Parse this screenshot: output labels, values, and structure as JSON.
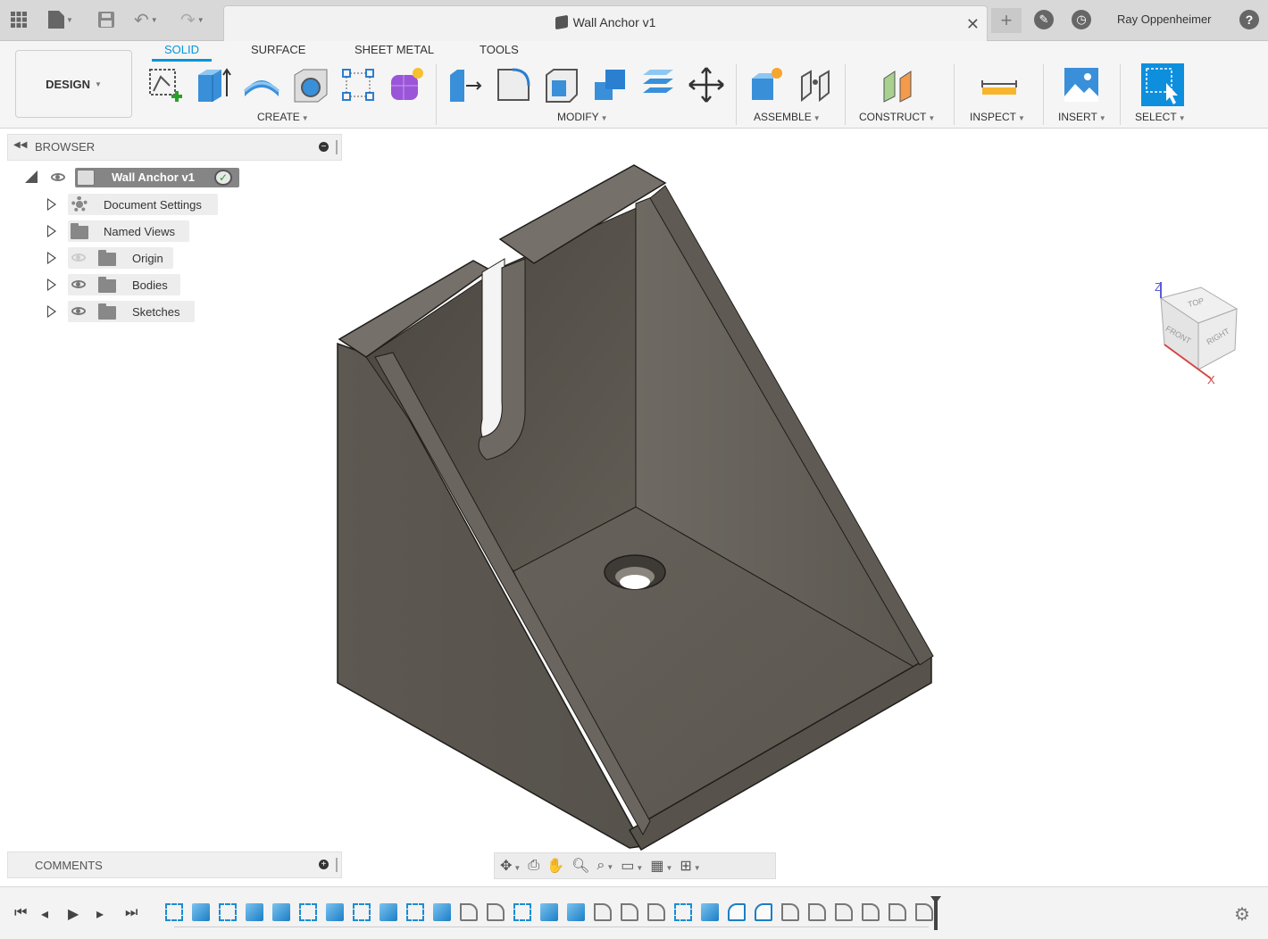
{
  "app": {
    "doc_title": "Wall Anchor v1",
    "user_name": "Ray Oppenheimer",
    "help": "?"
  },
  "workspace": {
    "design_label": "DESIGN",
    "tabs": [
      "SOLID",
      "SURFACE",
      "SHEET METAL",
      "TOOLS"
    ],
    "active_tab": "SOLID"
  },
  "toolbar": {
    "groups": {
      "create": "CREATE",
      "modify": "MODIFY",
      "assemble": "ASSEMBLE",
      "construct": "CONSTRUCT",
      "inspect": "INSPECT",
      "insert": "INSERT",
      "select": "SELECT"
    }
  },
  "browser": {
    "title": "BROWSER",
    "root": "Wall Anchor v1",
    "items": [
      {
        "label": "Document Settings",
        "icon": "gear-icon"
      },
      {
        "label": "Named Views",
        "icon": "folder-icon"
      },
      {
        "label": "Origin",
        "icon": "folder-icon",
        "visible": false
      },
      {
        "label": "Bodies",
        "icon": "folder-icon",
        "visible": true
      },
      {
        "label": "Sketches",
        "icon": "folder-icon",
        "visible": true
      }
    ]
  },
  "comments": {
    "title": "COMMENTS"
  },
  "viewcube": {
    "top": "TOP",
    "front": "FRONT",
    "right": "RIGHT",
    "axis_z": "Z",
    "axis_x": "X"
  },
  "colors": {
    "accent": "#0696d7",
    "model": "#5f5a53",
    "axis_z": "#5b5bd6",
    "axis_x": "#d64545"
  },
  "timeline": {
    "items": [
      "sketch",
      "body",
      "sketch",
      "body",
      "body",
      "sketch",
      "body",
      "sketch",
      "body",
      "sketch",
      "body",
      "fillet",
      "fillet",
      "sketch",
      "body",
      "body",
      "fillet",
      "fillet",
      "fillet",
      "sketch",
      "body",
      "fillet-b",
      "fillet-b",
      "fillet",
      "fillet",
      "fillet",
      "fillet",
      "fillet",
      "fillet"
    ]
  }
}
